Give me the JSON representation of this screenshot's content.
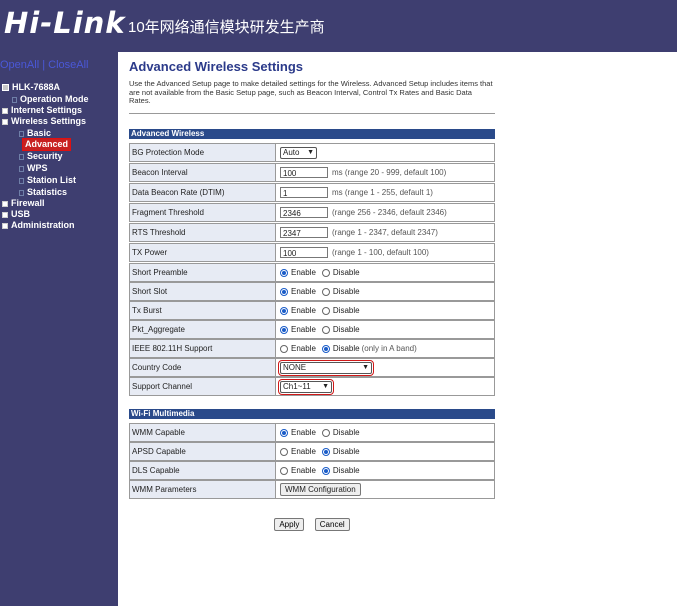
{
  "header": {
    "logo": "Hi-Link",
    "tagline": "10年网络通信模块研发生产商"
  },
  "sidebar": {
    "top_links": [
      "Open",
      "All",
      "Close",
      "All"
    ],
    "tree": [
      {
        "label": "HLK-7688A",
        "icon": "computer-icon"
      },
      {
        "label": "Operation Mode",
        "icon": "page-icon"
      },
      {
        "label": "Internet Settings",
        "icon": "expand-icon"
      },
      {
        "label": "Wireless Settings",
        "icon": "collapse-icon"
      },
      {
        "label": "Basic",
        "icon": "page-icon"
      },
      {
        "label": "Advanced",
        "icon": "page-icon",
        "selected": true
      },
      {
        "label": "Security",
        "icon": "page-icon"
      },
      {
        "label": "WPS",
        "icon": "page-icon"
      },
      {
        "label": "Station List",
        "icon": "page-icon"
      },
      {
        "label": "Statistics",
        "icon": "page-icon"
      },
      {
        "label": "Firewall",
        "icon": "expand-icon"
      },
      {
        "label": "USB",
        "icon": "expand-icon"
      },
      {
        "label": "Administration",
        "icon": "expand-icon"
      }
    ]
  },
  "main": {
    "title": "Advanced Wireless Settings",
    "description": "Use the Advanced Setup page to make detailed settings for the Wireless. Advanced Setup includes items that are not available from the Basic Setup page, such as Beacon Interval, Control Tx Rates and Basic Data Rates.",
    "advanced_section": "Advanced Wireless",
    "rows": {
      "bg_protection": {
        "label": "BG Protection Mode",
        "value": "Auto"
      },
      "beacon": {
        "label": "Beacon Interval",
        "value": "100",
        "hint": "ms (range 20 - 999, default 100)"
      },
      "dtim": {
        "label": "Data Beacon Rate (DTIM)",
        "value": "1",
        "hint": "ms (range 1 - 255, default 1)"
      },
      "frag": {
        "label": "Fragment Threshold",
        "value": "2346",
        "hint": "(range 256 - 2346, default 2346)"
      },
      "rts": {
        "label": "RTS Threshold",
        "value": "2347",
        "hint": "(range 1 - 2347, default 2347)"
      },
      "txpower": {
        "label": "TX Power",
        "value": "100",
        "hint": "(range 1 - 100, default 100)"
      },
      "short_preamble": {
        "label": "Short Preamble",
        "enable": "Enable",
        "disable": "Disable",
        "selected": "Enable"
      },
      "short_slot": {
        "label": "Short Slot",
        "enable": "Enable",
        "disable": "Disable",
        "selected": "Enable"
      },
      "tx_burst": {
        "label": "Tx Burst",
        "enable": "Enable",
        "disable": "Disable",
        "selected": "Enable"
      },
      "pkt_aggregate": {
        "label": "Pkt_Aggregate",
        "enable": "Enable",
        "disable": "Disable",
        "selected": "Enable"
      },
      "ieee80211h": {
        "label": "IEEE 802.11H Support",
        "enable": "Enable",
        "disable": "Disable",
        "note": "(only in A band)",
        "selected": "Disable"
      },
      "country": {
        "label": "Country Code",
        "value": "NONE"
      },
      "channel": {
        "label": "Support Channel",
        "value": "Ch1~11"
      }
    },
    "wmm_section": "Wi-Fi Multimedia",
    "wmm_rows": {
      "wmm_capable": {
        "label": "WMM Capable",
        "enable": "Enable",
        "disable": "Disable",
        "selected": "Enable"
      },
      "apsd_capable": {
        "label": "APSD Capable",
        "enable": "Enable",
        "disable": "Disable",
        "selected": "Disable"
      },
      "dls_capable": {
        "label": "DLS Capable",
        "enable": "Enable",
        "disable": "Disable",
        "selected": "Disable"
      },
      "wmm_params": {
        "label": "WMM Parameters",
        "button": "WMM Configuration"
      }
    },
    "apply": "Apply",
    "cancel": "Cancel"
  }
}
